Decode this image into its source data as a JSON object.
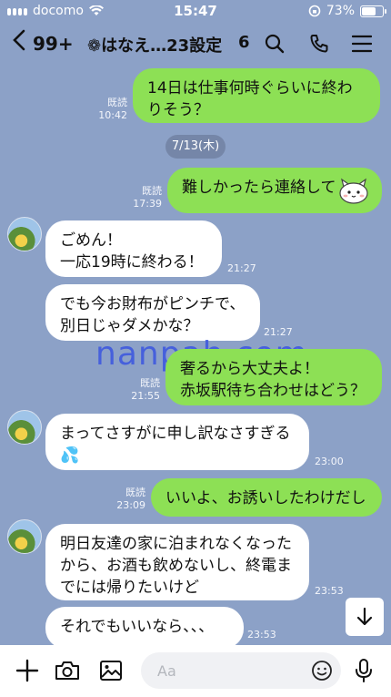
{
  "status_bar": {
    "carrier": "docomo",
    "time": "15:47",
    "battery": "73%",
    "battery_level": 0.73
  },
  "header": {
    "unread_count": "99+",
    "title": "❁はなえ…23設定",
    "member_count": "6"
  },
  "date_separator": "7/13(木)",
  "read_label": "既読",
  "messages": [
    {
      "dir": "out",
      "text": "14日は仕事何時ぐらいに終わりそう？",
      "time": "10:42",
      "read": true
    },
    {
      "dir": "out",
      "text": "難しかったら連絡して",
      "time": "17:39",
      "read": true,
      "sticker": "cat-emoji"
    },
    {
      "dir": "in",
      "text": "ごめん！\n一応19時に終わる！",
      "time": "21:27"
    },
    {
      "dir": "in",
      "text": "でも今お財布がピンチで、\n別日じゃダメかな？",
      "time": "21:27"
    },
    {
      "dir": "out",
      "text": "奢るから大丈夫よ！\n赤坂駅待ち合わせはどう？",
      "time": "21:55",
      "read": true
    },
    {
      "dir": "in",
      "text": "まってさすがに申し訳なさすぎる\n💦",
      "time": "23:00"
    },
    {
      "dir": "out",
      "text": "いいよ、お誘いしたわけだし",
      "time": "23:09",
      "read": true
    },
    {
      "dir": "in",
      "text": "明日友達の家に泊まれなくなったから、お酒も飲めないし、終電までには帰りたいけど",
      "time": "23:53"
    },
    {
      "dir": "in",
      "text": "それでもいいなら、、、",
      "time": "23:53"
    }
  ],
  "watermark": "nanpah.com",
  "input": {
    "placeholder": "Aa"
  },
  "colors": {
    "background": "#8ca1c7",
    "outgoing_bubble": "#8de055",
    "incoming_bubble": "#ffffff"
  }
}
